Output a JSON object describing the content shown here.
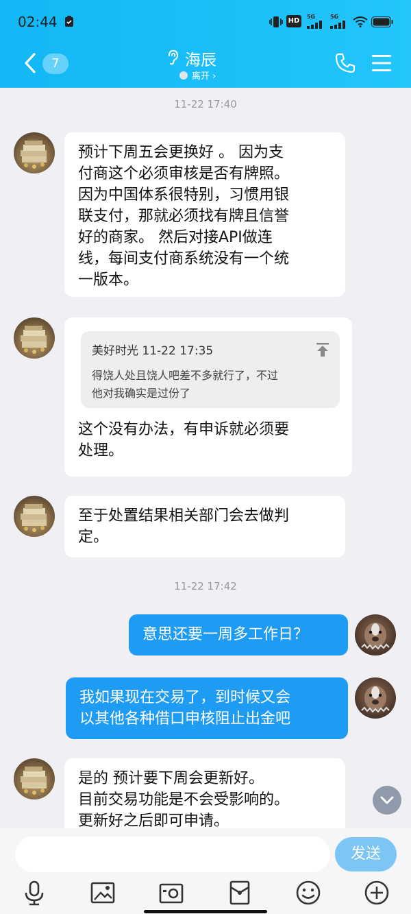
{
  "status_bar": {
    "time": "02:44",
    "hd_label": "HD",
    "net1": "5G",
    "net2": "5G"
  },
  "header": {
    "unread_count": "7",
    "contact_name": "海辰",
    "presence": "离开 ›"
  },
  "messages": {
    "timestamp1": "11-22 17:40",
    "m1": {
      "lines": [
        "预计下周五会更换好 。 因为支",
        "付商这个必须审核是否有牌照。",
        "因为中国体系很特别，习惯用银",
        "联支付，那就必须找有牌且信誉",
        "好的商家。 然后对接API做连",
        "线，每间支付商系统没有一个统",
        "一版本。"
      ]
    },
    "m2": {
      "quote_header": "美好时光 11-22 17:35",
      "quote_lines": [
        "得饶人处且饶人吧差不多就行了，不过",
        "他对我确实是过份了"
      ],
      "lines": [
        "这个没有办法，有申诉就必须要",
        "处理。"
      ]
    },
    "m3": {
      "lines": [
        "至于处置结果相关部门会去做判",
        "定。"
      ]
    },
    "timestamp2": "11-22 17:42",
    "m4": {
      "lines": [
        "意思还要一周多工作日？"
      ]
    },
    "m5": {
      "lines": [
        "我如果现在交易了，到时候又会",
        "以其他各种借口申核阻止出金吧"
      ]
    },
    "m6": {
      "lines": [
        "是的  预计要下周会更新好。",
        "目前交易功能是不会受影响的。",
        "更新好之后即可申请。"
      ]
    }
  },
  "input": {
    "value": "",
    "send_label": "发送"
  },
  "colors": {
    "header_bg": "#12b7f5",
    "outgoing_bubble": "#1e9bf2",
    "send_button": "#7cc6f6"
  }
}
